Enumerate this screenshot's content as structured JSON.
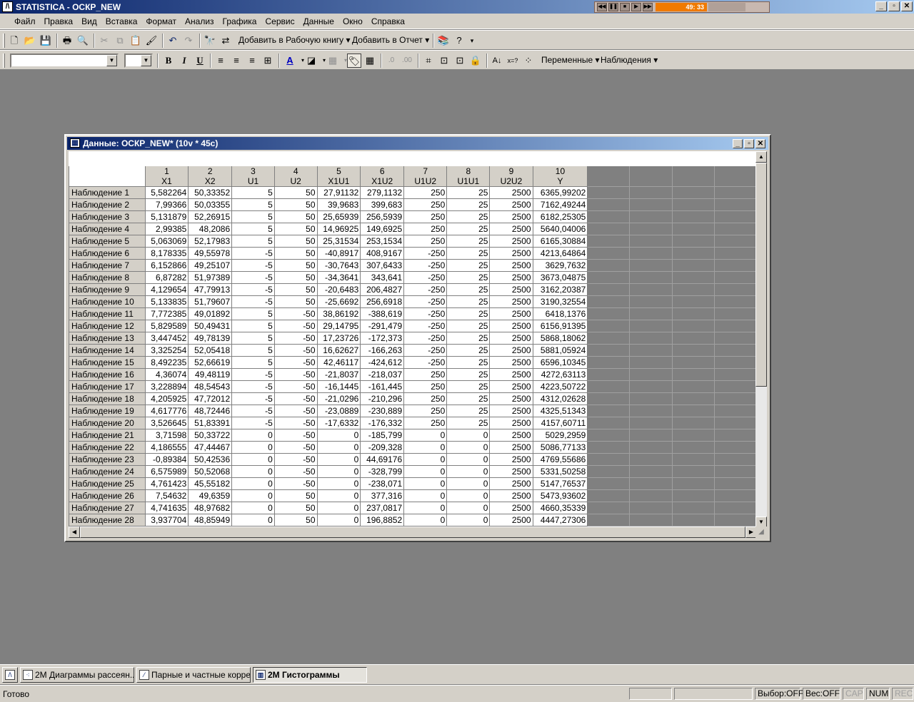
{
  "app": {
    "title": "STATISTICA - ОСКР_NEW",
    "app_icon": "statistica-icon",
    "media_time": "49: 33",
    "window_controls": [
      "_",
      "▫",
      "✕"
    ]
  },
  "menu": {
    "items": [
      "Файл",
      "Правка",
      "Вид",
      "Вставка",
      "Формат",
      "Анализ",
      "Графика",
      "Сервис",
      "Данные",
      "Окно",
      "Справка"
    ]
  },
  "toolbar1": {
    "add_workbook": "Добавить в Рабочую книгу ▾",
    "add_report": "Добавить в Отчет ▾"
  },
  "toolbar2": {
    "font_name": "",
    "font_size": "",
    "bold": "B",
    "italic": "I",
    "underline": "U",
    "variables": "Переменные ▾",
    "cases": "Наблюдения ▾"
  },
  "sheet": {
    "title": "Данные: ОСКР_NEW* (10v * 45c)",
    "columns": [
      {
        "num": "1",
        "name": "X1"
      },
      {
        "num": "2",
        "name": "X2"
      },
      {
        "num": "3",
        "name": "U1"
      },
      {
        "num": "4",
        "name": "U2"
      },
      {
        "num": "5",
        "name": "X1U1"
      },
      {
        "num": "6",
        "name": "X1U2"
      },
      {
        "num": "7",
        "name": "U1U2"
      },
      {
        "num": "8",
        "name": "U1U1"
      },
      {
        "num": "9",
        "name": "U2U2"
      },
      {
        "num": "10",
        "name": "Y"
      }
    ],
    "rows": [
      {
        "label": "Наблюдение 1",
        "values": [
          "5,582264",
          "50,33352",
          "5",
          "50",
          "27,91132",
          "279,1132",
          "250",
          "25",
          "2500",
          "6365,99202"
        ]
      },
      {
        "label": "Наблюдение 2",
        "values": [
          "7,99366",
          "50,03355",
          "5",
          "50",
          "39,9683",
          "399,683",
          "250",
          "25",
          "2500",
          "7162,49244"
        ]
      },
      {
        "label": "Наблюдение 3",
        "values": [
          "5,131879",
          "52,26915",
          "5",
          "50",
          "25,65939",
          "256,5939",
          "250",
          "25",
          "2500",
          "6182,25305"
        ]
      },
      {
        "label": "Наблюдение 4",
        "values": [
          "2,99385",
          "48,2086",
          "5",
          "50",
          "14,96925",
          "149,6925",
          "250",
          "25",
          "2500",
          "5640,04006"
        ]
      },
      {
        "label": "Наблюдение 5",
        "values": [
          "5,063069",
          "52,17983",
          "5",
          "50",
          "25,31534",
          "253,1534",
          "250",
          "25",
          "2500",
          "6165,30884"
        ]
      },
      {
        "label": "Наблюдение 6",
        "values": [
          "8,178335",
          "49,55978",
          "-5",
          "50",
          "-40,8917",
          "408,9167",
          "-250",
          "25",
          "2500",
          "4213,64864"
        ]
      },
      {
        "label": "Наблюдение 7",
        "values": [
          "6,152866",
          "49,25107",
          "-5",
          "50",
          "-30,7643",
          "307,6433",
          "-250",
          "25",
          "2500",
          "3629,7632"
        ]
      },
      {
        "label": "Наблюдение 8",
        "values": [
          "6,87282",
          "51,97389",
          "-5",
          "50",
          "-34,3641",
          "343,641",
          "-250",
          "25",
          "2500",
          "3673,04875"
        ]
      },
      {
        "label": "Наблюдение 9",
        "values": [
          "4,129654",
          "47,79913",
          "-5",
          "50",
          "-20,6483",
          "206,4827",
          "-250",
          "25",
          "2500",
          "3162,20387"
        ]
      },
      {
        "label": "Наблюдение 10",
        "values": [
          "5,133835",
          "51,79607",
          "-5",
          "50",
          "-25,6692",
          "256,6918",
          "-250",
          "25",
          "2500",
          "3190,32554"
        ]
      },
      {
        "label": "Наблюдение 11",
        "values": [
          "7,772385",
          "49,01892",
          "5",
          "-50",
          "38,86192",
          "-388,619",
          "-250",
          "25",
          "2500",
          "6418,1376"
        ]
      },
      {
        "label": "Наблюдение 12",
        "values": [
          "5,829589",
          "50,49431",
          "5",
          "-50",
          "29,14795",
          "-291,479",
          "-250",
          "25",
          "2500",
          "6156,91395"
        ]
      },
      {
        "label": "Наблюдение 13",
        "values": [
          "3,447452",
          "49,78139",
          "5",
          "-50",
          "17,23726",
          "-172,373",
          "-250",
          "25",
          "2500",
          "5868,18062"
        ]
      },
      {
        "label": "Наблюдение 14",
        "values": [
          "3,325254",
          "52,05418",
          "5",
          "-50",
          "16,62627",
          "-166,263",
          "-250",
          "25",
          "2500",
          "5881,05924"
        ]
      },
      {
        "label": "Наблюдение 15",
        "values": [
          "8,492235",
          "52,66619",
          "5",
          "-50",
          "42,46117",
          "-424,612",
          "-250",
          "25",
          "2500",
          "6596,10345"
        ]
      },
      {
        "label": "Наблюдение 16",
        "values": [
          "4,36074",
          "49,48119",
          "-5",
          "-50",
          "-21,8037",
          "-218,037",
          "250",
          "25",
          "2500",
          "4272,63113"
        ]
      },
      {
        "label": "Наблюдение 17",
        "values": [
          "3,228894",
          "48,54543",
          "-5",
          "-50",
          "-16,1445",
          "-161,445",
          "250",
          "25",
          "2500",
          "4223,50722"
        ]
      },
      {
        "label": "Наблюдение 18",
        "values": [
          "4,205925",
          "47,72012",
          "-5",
          "-50",
          "-21,0296",
          "-210,296",
          "250",
          "25",
          "2500",
          "4312,02628"
        ]
      },
      {
        "label": "Наблюдение 19",
        "values": [
          "4,617776",
          "48,72446",
          "-5",
          "-50",
          "-23,0889",
          "-230,889",
          "250",
          "25",
          "2500",
          "4325,51343"
        ]
      },
      {
        "label": "Наблюдение 20",
        "values": [
          "3,526645",
          "51,83391",
          "-5",
          "-50",
          "-17,6332",
          "-176,332",
          "250",
          "25",
          "2500",
          "4157,60711"
        ]
      },
      {
        "label": "Наблюдение 21",
        "values": [
          "3,71598",
          "50,33722",
          "0",
          "-50",
          "0",
          "-185,799",
          "0",
          "0",
          "2500",
          "5029,2959"
        ]
      },
      {
        "label": "Наблюдение 22",
        "values": [
          "4,186555",
          "47,44467",
          "0",
          "-50",
          "0",
          "-209,328",
          "0",
          "0",
          "2500",
          "5086,77133"
        ]
      },
      {
        "label": "Наблюдение 23",
        "values": [
          "-0,89384",
          "50,42536",
          "0",
          "-50",
          "0",
          "44,69176",
          "0",
          "0",
          "2500",
          "4769,55686"
        ]
      },
      {
        "label": "Наблюдение 24",
        "values": [
          "6,575989",
          "50,52068",
          "0",
          "-50",
          "0",
          "-328,799",
          "0",
          "0",
          "2500",
          "5331,50258"
        ]
      },
      {
        "label": "Наблюдение 25",
        "values": [
          "4,761423",
          "45,55182",
          "0",
          "-50",
          "0",
          "-238,071",
          "0",
          "0",
          "2500",
          "5147,76537"
        ]
      },
      {
        "label": "Наблюдение 26",
        "values": [
          "7,54632",
          "49,6359",
          "0",
          "50",
          "0",
          "377,316",
          "0",
          "0",
          "2500",
          "5473,93602"
        ]
      },
      {
        "label": "Наблюдение 27",
        "values": [
          "4,741635",
          "48,97682",
          "0",
          "50",
          "0",
          "237,0817",
          "0",
          "0",
          "2500",
          "4660,35339"
        ]
      },
      {
        "label": "Наблюдение 28",
        "values": [
          "3,937704",
          "48,85949",
          "0",
          "50",
          "0",
          "196,8852",
          "0",
          "0",
          "2500",
          "4447,27306"
        ]
      }
    ]
  },
  "taskbar": {
    "items": [
      {
        "label": "2M Диаграммы рассеян...",
        "icon": "scatterplot-icon",
        "active": false
      },
      {
        "label": "Парные и частные корре...",
        "icon": "correlation-chart-icon",
        "active": false
      },
      {
        "label": "2M Гистограммы",
        "icon": "histogram-icon",
        "active": true
      }
    ]
  },
  "status": {
    "ready": "Готово",
    "selection": "Выбор:OFF",
    "weight": "Вес:OFF",
    "cap": "CAP",
    "num": "NUM",
    "rec": "REC"
  }
}
